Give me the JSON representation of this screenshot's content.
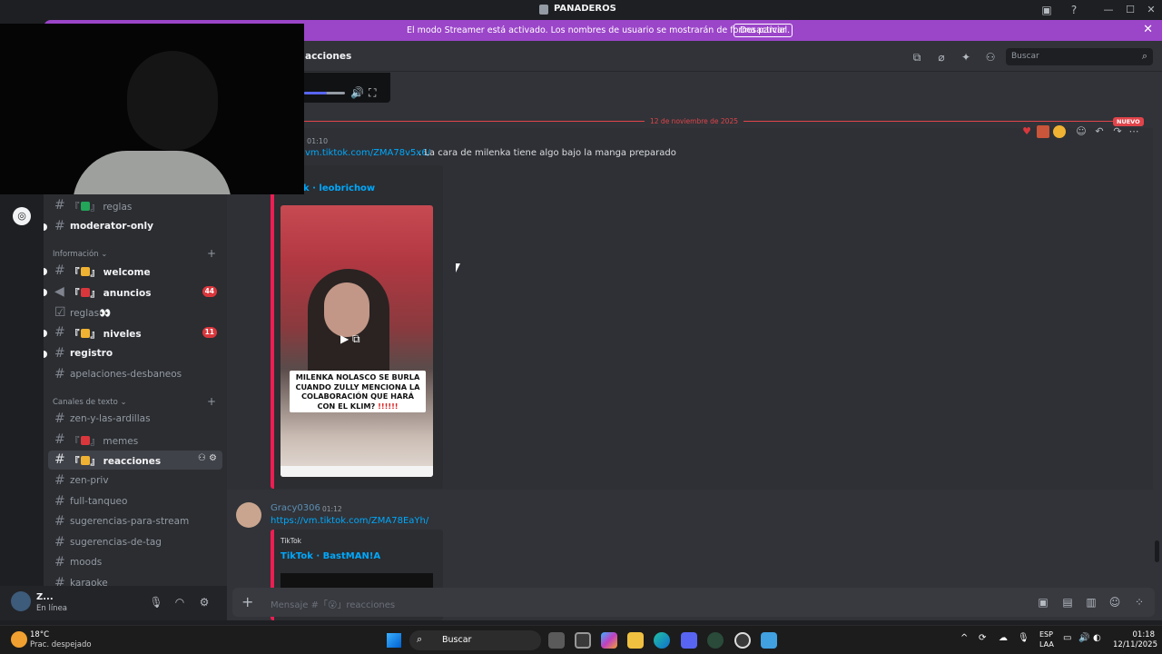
{
  "window": {
    "title": "PANADEROS",
    "controls": {
      "minimize": "—",
      "maximize": "☐",
      "close": "✕"
    }
  },
  "banner": {
    "text": "El modo Streamer está activado. Los nombres de usuario se mostrarán de forma parcial.",
    "button": "Desactivar"
  },
  "sidebar": {
    "channels_top": [
      {
        "prefix": "『",
        "suffix": "』",
        "name": "reglas",
        "unread": false
      },
      {
        "name": "moderator-only",
        "unread": true
      }
    ],
    "category_info": "Información",
    "info_channels": [
      {
        "name": "welcome",
        "unread": true,
        "emoji_color": "#f0b232"
      },
      {
        "name": "anuncios",
        "unread": true,
        "badge": "44",
        "emoji_color": "#da373c"
      },
      {
        "name": "reglas",
        "unread": false,
        "suffix": "👀"
      },
      {
        "name": "niveles",
        "unread": true,
        "badge": "11",
        "emoji_color": "#f0b232"
      },
      {
        "name": "registro",
        "unread": true
      },
      {
        "name": "apelaciones-desbaneos",
        "unread": false
      }
    ],
    "category_text": "Canales de texto",
    "text_channels": [
      {
        "name": "zen-y-las-ardillas"
      },
      {
        "name": "memes",
        "emoji_color": "#da373c"
      },
      {
        "name": "reacciones",
        "active": true,
        "emoji_color": "#f0b232"
      },
      {
        "name": "zen-priv"
      },
      {
        "name": "full-tanqueo"
      },
      {
        "name": "sugerencias-para-stream"
      },
      {
        "name": "sugerencias-de-tag"
      },
      {
        "name": "moods"
      },
      {
        "name": "karaoke"
      }
    ]
  },
  "user": {
    "name": "Z...",
    "status": "En línea"
  },
  "header": {
    "channel": "acciones",
    "search_placeholder": "Buscar"
  },
  "messages": {
    "divider_date": "12 de noviembre de 2025",
    "new_tag": "NUEVO",
    "first": {
      "time": "01:10",
      "link": "vm.tiktok.com/ZMA78v5x6/",
      "text": ". La cara de milenka tiene algo bajo la manga preparado",
      "embed_title": "k · leobrichow",
      "video_caption_1": "MILENKA NOLASCO SE BURLA CUANDO ZULLY MENCIONA LA COLABORACIÓN QUE HARÁ CON EL KLIM?",
      "video_caption_marks": "!!!!!!"
    },
    "second": {
      "author": "Gracy0306",
      "time": "01:12",
      "link": "https://vm.tiktok.com/ZMA78EaYh/",
      "embed_provider": "TikTok",
      "embed_title": "TikTok · BastMAN!A"
    }
  },
  "composer": {
    "placeholder": "Mensaje #「😮」reacciones"
  },
  "taskbar": {
    "weather_temp": "18°C",
    "weather_desc": "Prac. despejado",
    "search": "Buscar",
    "lang_1": "ESP",
    "lang_2": "LAA",
    "time": "01:18",
    "date": "12/11/2025"
  },
  "colors": {
    "banner": "#9b45c9",
    "tiktok_accent": "#ee1d52",
    "link": "#00a8fc",
    "divider": "#e0444a"
  }
}
